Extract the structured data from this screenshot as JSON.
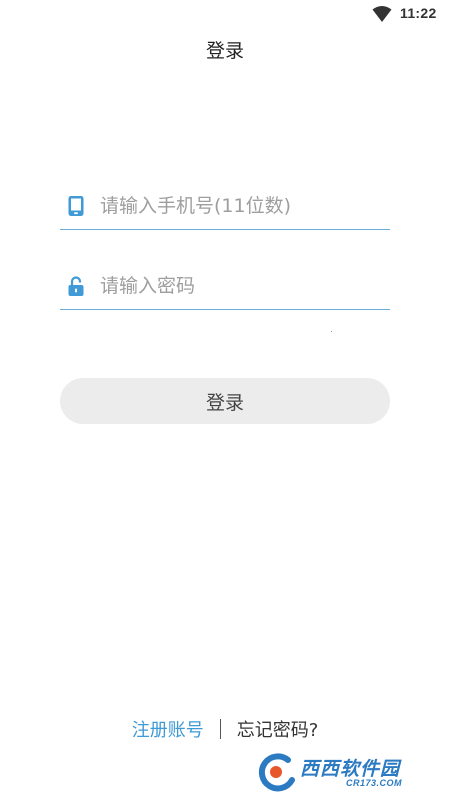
{
  "status_bar": {
    "time": "11:22",
    "wifi_icon": "wifi-icon"
  },
  "header": {
    "title": "登录"
  },
  "form": {
    "phone": {
      "icon": "phone-icon",
      "placeholder": "请输入手机号(11位数)",
      "value": ""
    },
    "password": {
      "icon": "lock-icon",
      "placeholder": "请输入密码",
      "value": ""
    },
    "login_label": "登录"
  },
  "footer": {
    "register_label": "注册账号",
    "forgot_label": "忘记密码?"
  },
  "watermark": {
    "brand": "西西软件园",
    "domain": "CR173.COM"
  },
  "colors": {
    "accent": "#6aaedb",
    "link": "#3f9ad6",
    "button_bg": "#ececec",
    "icon": "#3f9ad6"
  }
}
